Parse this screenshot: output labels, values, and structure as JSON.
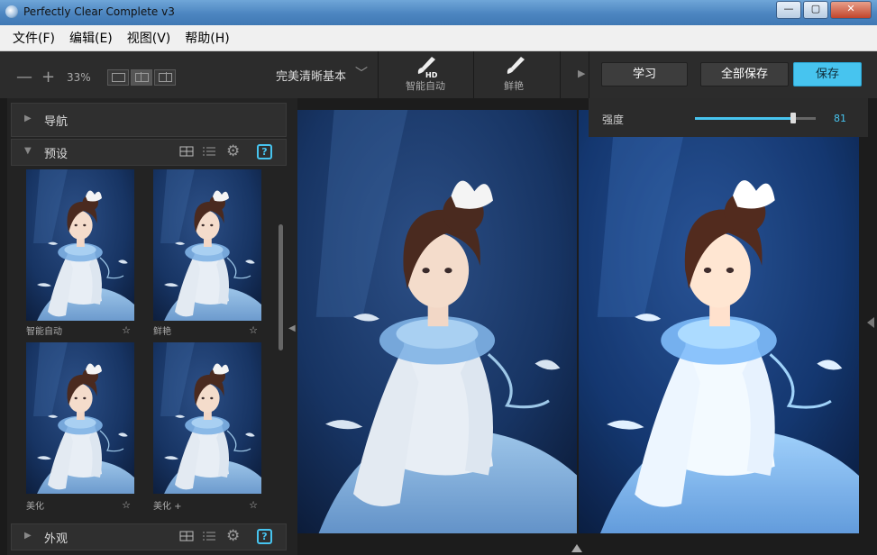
{
  "window": {
    "title": "Perfectly Clear Complete v3",
    "controls": [
      "—",
      "▢",
      "✕"
    ]
  },
  "menu": [
    "文件(F)",
    "编辑(E)",
    "视图(V)",
    "帮助(H)"
  ],
  "toolbar": {
    "zoom_out": "—",
    "zoom_in": "+",
    "zoom_level": "33%",
    "preset": "完美清晰基本",
    "tools": [
      {
        "label": "智能自动",
        "icon": "brush-hd-icon",
        "badge": "HD"
      },
      {
        "label": "鲜艳",
        "icon": "brush-icon"
      }
    ],
    "learn": "学习",
    "save_all": "全部保存",
    "save": "保存"
  },
  "panel": {
    "navigate": "导航",
    "presets": "预设",
    "appearance": "外观",
    "thumbs": [
      "智能自动",
      "鲜艳",
      "美化",
      "美化 +"
    ]
  },
  "strength": {
    "label": "强度",
    "value": 81,
    "max": 100
  },
  "colors": {
    "accent": "#47c4ef",
    "bg": "#2b2b2b"
  }
}
